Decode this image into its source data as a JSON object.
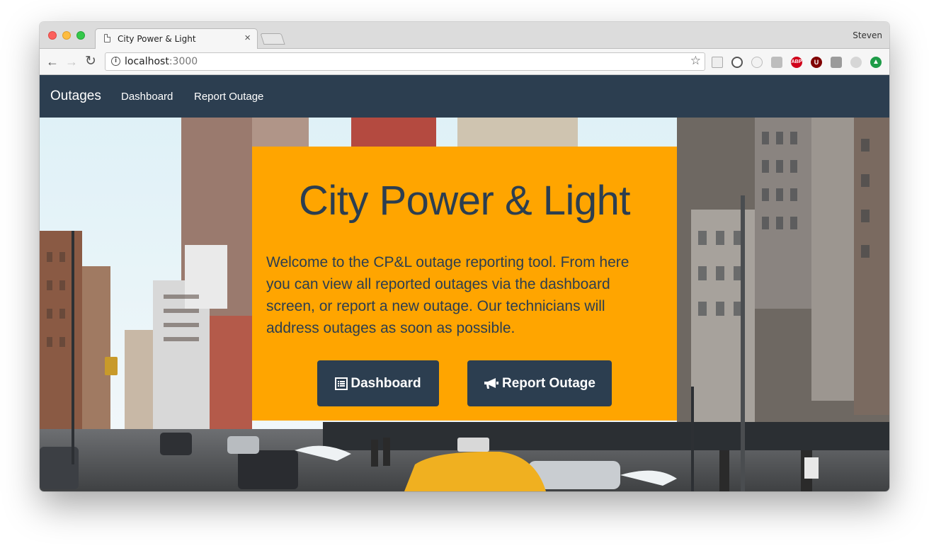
{
  "browser": {
    "tab_title": "City Power & Light",
    "tab_close": "×",
    "profile_name": "Steven",
    "url_host": "localhost",
    "url_port": ":3000",
    "info_glyph": "i",
    "star_glyph": "☆",
    "back_glyph": "←",
    "forward_glyph": "→",
    "reload_glyph": "↻",
    "extensions": [
      {
        "name": "rss-extension-icon"
      },
      {
        "name": "sync-extension-icon"
      },
      {
        "name": "ghost-extension-icon"
      },
      {
        "name": "n-extension-icon"
      },
      {
        "name": "adblock-plus-icon",
        "label": "ABP",
        "color": "#d0021b"
      },
      {
        "name": "ublock-icon",
        "label": "U",
        "color": "#800000"
      },
      {
        "name": "pocket-extension-icon"
      },
      {
        "name": "m-extension-icon"
      },
      {
        "name": "upload-extension-icon",
        "color": "#1e9c48"
      }
    ]
  },
  "navbar": {
    "brand": "Outages",
    "links": [
      "Dashboard",
      "Report Outage"
    ],
    "color": "#2c3e50"
  },
  "hero": {
    "title": "City Power & Light",
    "body": "Welcome to the CP&L outage reporting tool. From here you can view all reported outages via the dashboard screen, or report a new outage. Our technicians will address outages as soon as possible.",
    "card_color": "#ffa500",
    "buttons": [
      {
        "label": "Dashboard",
        "icon": "list-icon"
      },
      {
        "label": "Report Outage",
        "icon": "bullhorn-icon"
      }
    ]
  }
}
